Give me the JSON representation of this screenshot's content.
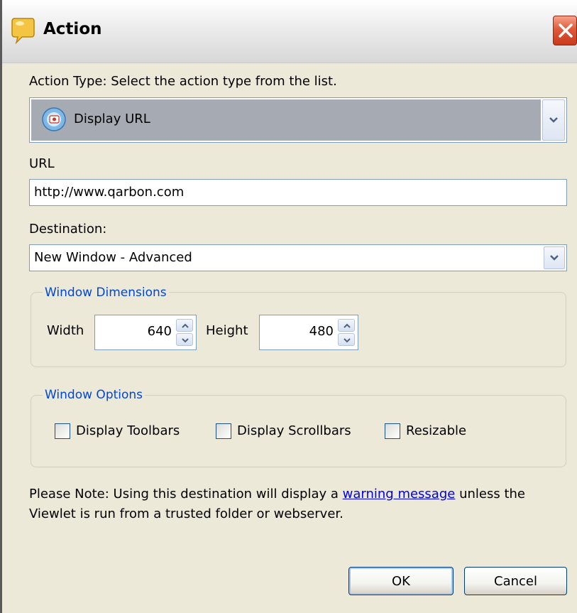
{
  "window": {
    "title": "Action"
  },
  "action_type": {
    "label": "Action Type: Select the action type from the list.",
    "selected": "Display URL"
  },
  "url": {
    "label": "URL",
    "value": "http://www.qarbon.com"
  },
  "destination": {
    "label": "Destination:",
    "selected": "New Window - Advanced"
  },
  "window_dimensions": {
    "legend": "Window Dimensions",
    "width_label": "Width",
    "width_value": "640",
    "height_label": "Height",
    "height_value": "480"
  },
  "window_options": {
    "legend": "Window Options",
    "options": [
      {
        "label": "Display Toolbars",
        "checked": false
      },
      {
        "label": "Display Scrollbars",
        "checked": false
      },
      {
        "label": "Resizable",
        "checked": false
      }
    ]
  },
  "note": {
    "prefix": "Please Note: Using this destination will display a",
    "link": "warning message",
    "suffix": "unless the Viewlet is run from a trusted folder or webserver."
  },
  "buttons": {
    "ok": "OK",
    "cancel": "Cancel"
  },
  "colors": {
    "legend": "#0046d5",
    "link": "#0000ee",
    "dialog_bg": "#ece9d8",
    "close_button": "#e0593a"
  }
}
